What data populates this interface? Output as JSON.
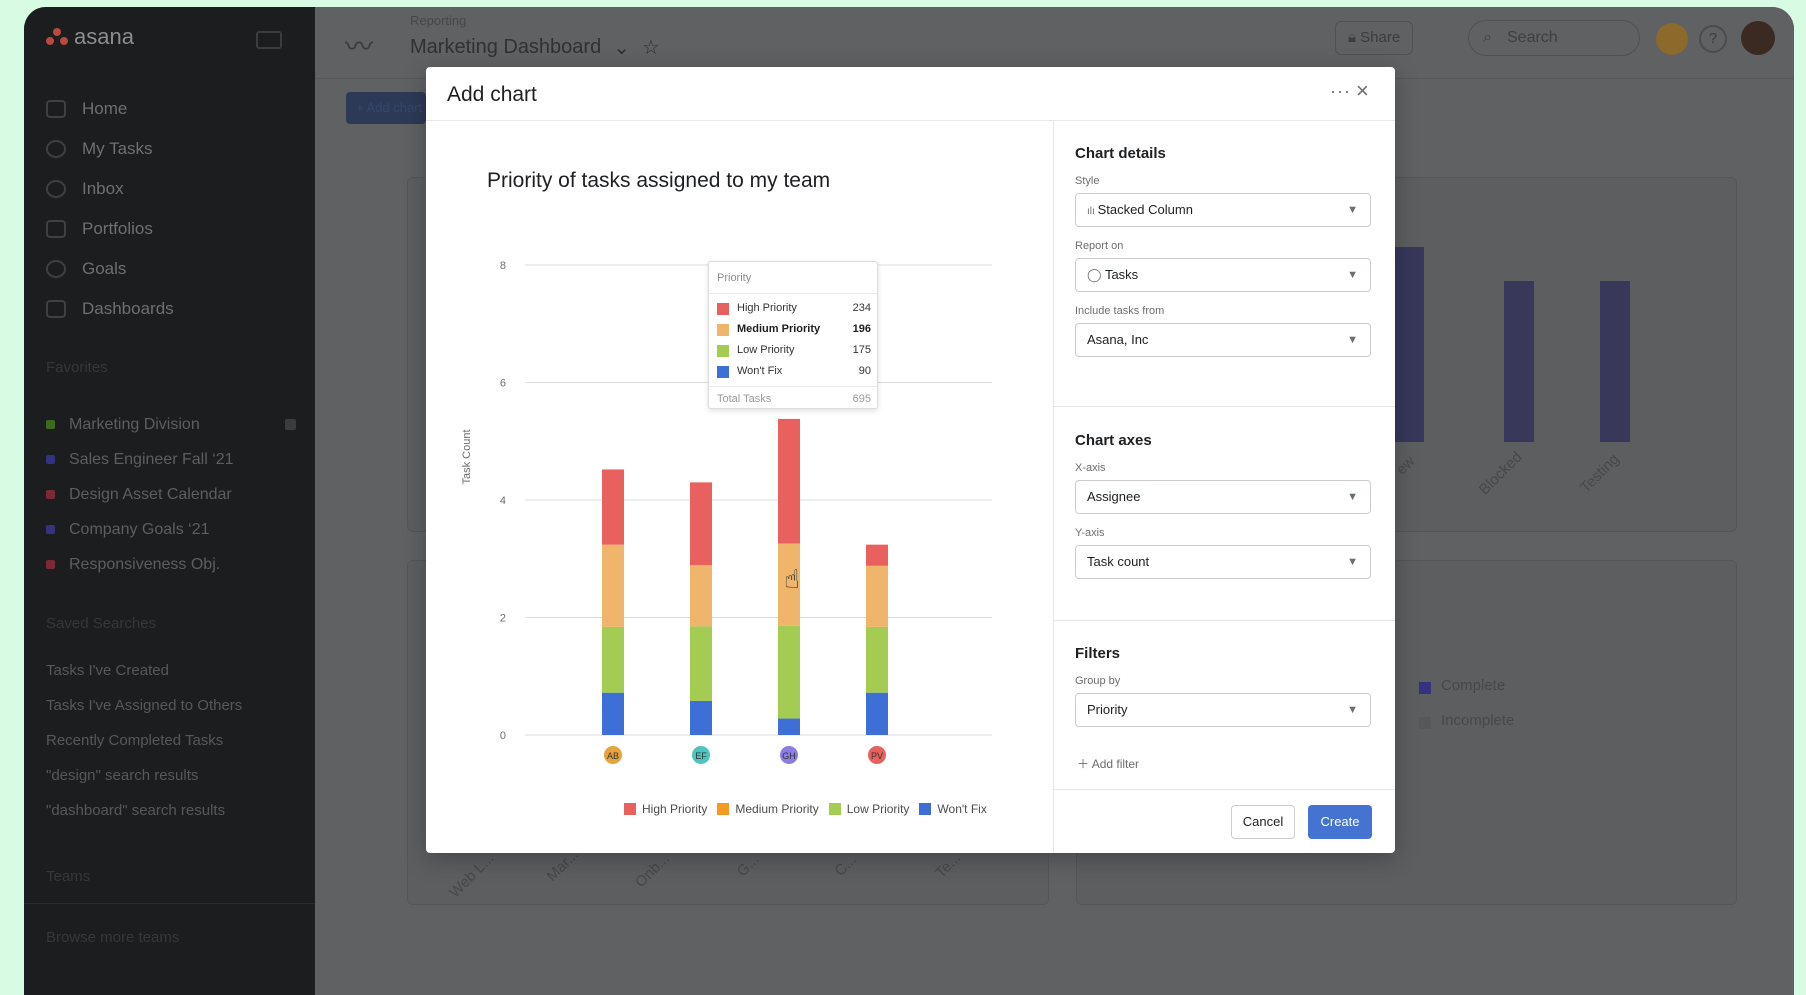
{
  "app": {
    "logo_text": "asana"
  },
  "sidebar": {
    "nav": [
      {
        "label": "Home",
        "icon": "home-icon"
      },
      {
        "label": "My Tasks",
        "icon": "check-circle-icon"
      },
      {
        "label": "Inbox",
        "icon": "bell-icon"
      },
      {
        "label": "Portfolios",
        "icon": "bar-chart-icon"
      },
      {
        "label": "Goals",
        "icon": "person-icon"
      },
      {
        "label": "Dashboards",
        "icon": "dashboard-icon"
      }
    ],
    "favorites_title": "Favorites",
    "favorites": [
      {
        "label": "Marketing Division",
        "color": "#5d9b2d"
      },
      {
        "label": "Sales Engineer Fall ‘21",
        "color": "#4b4ad0"
      },
      {
        "label": "Design Asset Calendar",
        "color": "#c0394f"
      },
      {
        "label": "Company Goals ‘21",
        "color": "#4b4ad0"
      },
      {
        "label": "Responsiveness Obj.",
        "color": "#c0394f"
      }
    ],
    "saved_title": "Saved Searches",
    "saved": [
      "Tasks I've Created",
      "Tasks I've Assigned to Others",
      "Recently Completed Tasks",
      "\"design\" search results",
      "\"dashboard\" search results"
    ],
    "teams_title": "Teams",
    "browse_teams": "Browse more teams"
  },
  "topbar": {
    "breadcrumb": "Reporting",
    "title": "Marketing Dashboard",
    "share": "Share",
    "search_placeholder": "Search",
    "add_chart": "+ Add chart"
  },
  "background": {
    "bar_labels": [
      "ew",
      "Blocked",
      "Testing"
    ],
    "x_labels": [
      "Web L...",
      "Mar...",
      "Onb...",
      "G...",
      "C...",
      "Te..."
    ],
    "legend": [
      "Complete",
      "Incomplete"
    ]
  },
  "modal": {
    "title": "Add chart",
    "more": "···",
    "close": "×",
    "chart": {
      "title": "Priority of tasks assigned to my team",
      "ylabel": "Task Count",
      "yticks": [
        "0",
        "2",
        "4",
        "6",
        "8"
      ],
      "avatars": [
        "AB",
        "EF",
        "GH",
        "PV"
      ]
    },
    "tooltip": {
      "header": "Priority",
      "rows": [
        {
          "label": "High Priority",
          "value": "234",
          "color": "#e8615f"
        },
        {
          "label": "Medium Priority",
          "value": "196",
          "color": "#efb66b"
        },
        {
          "label": "Low Priority",
          "value": "175",
          "color": "#a4cb52"
        },
        {
          "label": "Won't Fix",
          "value": "90",
          "color": "#3d6fd6"
        }
      ],
      "total_label": "Total Tasks",
      "total_value": "695"
    },
    "legend": [
      {
        "label": "High Priority",
        "color": "#e8615f"
      },
      {
        "label": "Medium Priority",
        "color": "#f59a23"
      },
      {
        "label": "Low Priority",
        "color": "#a4cb52"
      },
      {
        "label": "Won't Fix",
        "color": "#3d6fd6"
      }
    ],
    "panel": {
      "details_title": "Chart details",
      "style_label": "Style",
      "style_value": "Stacked Column",
      "report_label": "Report on",
      "report_value": "Tasks",
      "include_label": "Include tasks from",
      "include_value": "Asana, Inc",
      "axes_title": "Chart axes",
      "xaxis_label": "X-axis",
      "xaxis_value": "Assignee",
      "yaxis_label": "Y-axis",
      "yaxis_value": "Task count",
      "filters_title": "Filters",
      "group_label": "Group by",
      "group_value": "Priority",
      "add_filter": "Add filter",
      "cancel": "Cancel",
      "create": "Create"
    }
  },
  "chart_data": {
    "type": "bar",
    "stacked": true,
    "title": "Priority of tasks assigned to my team",
    "xlabel": "",
    "ylabel": "Task Count",
    "ylim": [
      0,
      8
    ],
    "categories": [
      "AB",
      "EF",
      "GH",
      "PV"
    ],
    "series": [
      {
        "name": "Won't Fix",
        "color": "#3d6fd6",
        "values": [
          0.72,
          0.58,
          0.28,
          0.72
        ]
      },
      {
        "name": "Low Priority",
        "color": "#a4cb52",
        "values": [
          1.12,
          1.27,
          1.58,
          1.12
        ]
      },
      {
        "name": "Medium Priority",
        "color": "#efb66b",
        "values": [
          1.4,
          1.04,
          1.4,
          1.04
        ]
      },
      {
        "name": "High Priority",
        "color": "#e8615f",
        "values": [
          1.28,
          1.41,
          2.12,
          0.36
        ]
      }
    ],
    "avatar_colors": [
      "#e6a53c",
      "#4cc4c0",
      "#8b7ce6",
      "#e8615f"
    ],
    "grid": true,
    "legend_position": "bottom-right"
  }
}
